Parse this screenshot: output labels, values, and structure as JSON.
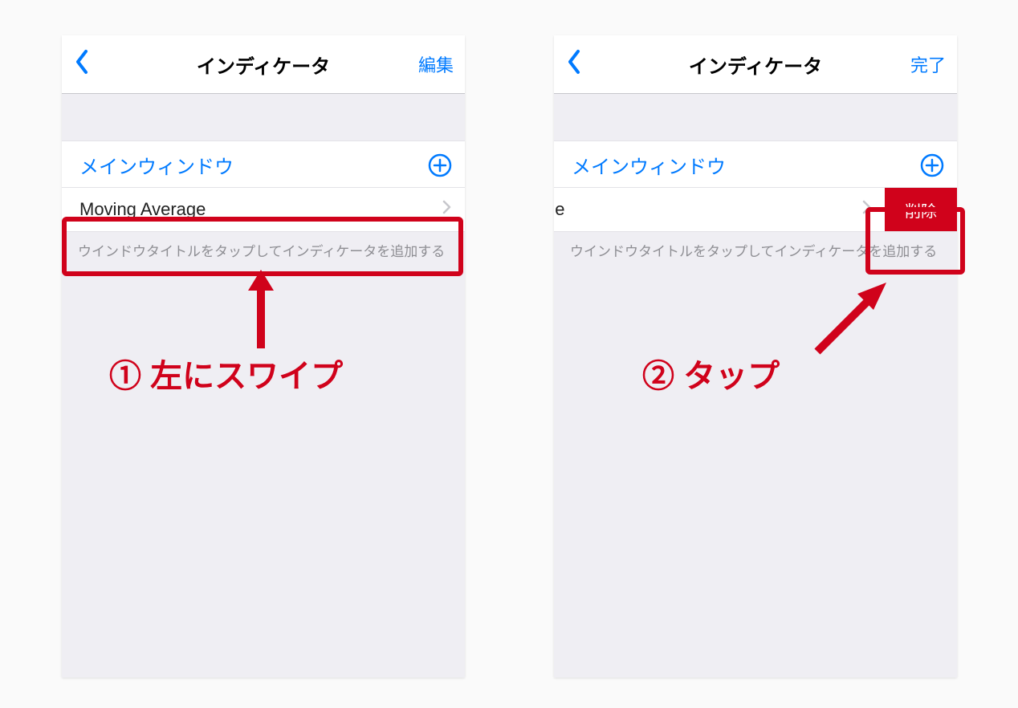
{
  "left": {
    "nav_title": "インディケータ",
    "nav_action": "編集",
    "section_title": "メインウィンドウ",
    "row_label": "Moving Average",
    "hint": "ウインドウタイトルをタップしてインディケータを追加する",
    "caption": "① 左にスワイプ"
  },
  "right": {
    "nav_title": "インディケータ",
    "nav_action": "完了",
    "section_title": "メインウィンドウ",
    "row_label": "Average",
    "delete_label": "削除",
    "hint": "ウインドウタイトルをタップしてインディケータを追加する",
    "caption": "② タップ"
  },
  "colors": {
    "accent": "#007aff",
    "danger": "#d0021b"
  }
}
